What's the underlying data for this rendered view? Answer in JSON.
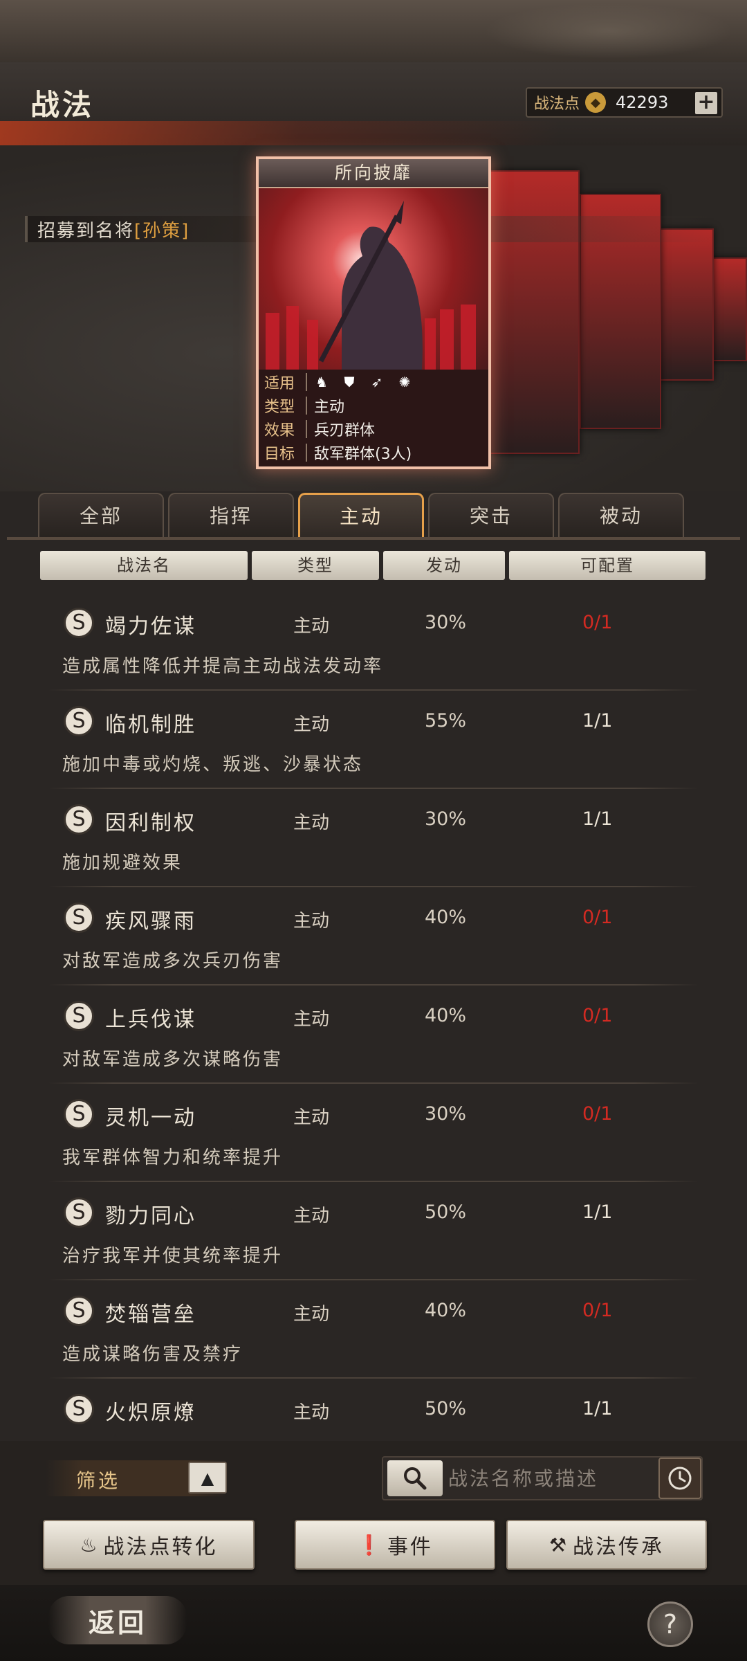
{
  "header": {
    "title": "战法",
    "points_label": "战法点",
    "points_value": "42293",
    "add_label": "+"
  },
  "recruit": {
    "text": "招募到名将",
    "name": "[孙策]"
  },
  "featured_card": {
    "title": "所向披靡",
    "info": [
      {
        "key": "适用",
        "value": ""
      },
      {
        "key": "类型",
        "value": "主动"
      },
      {
        "key": "效果",
        "value": "兵刃群体"
      },
      {
        "key": "目标",
        "value": "敌军群体(3人)"
      }
    ],
    "unit_icons": [
      "cavalry-icon",
      "shield-icon",
      "archer-icon",
      "chariot-icon"
    ]
  },
  "tabs": [
    {
      "label": "全部",
      "active": false
    },
    {
      "label": "指挥",
      "active": false
    },
    {
      "label": "主动",
      "active": true
    },
    {
      "label": "突击",
      "active": false
    },
    {
      "label": "被动",
      "active": false
    }
  ],
  "table_headers": [
    "战法名",
    "类型",
    "发动",
    "可配置"
  ],
  "skills": [
    {
      "grade": "S",
      "name": "竭力佐谋",
      "type": "主动",
      "rate": "30%",
      "slot": "0/1",
      "slot_full": true,
      "desc": "造成属性降低并提高主动战法发动率"
    },
    {
      "grade": "S",
      "name": "临机制胜",
      "type": "主动",
      "rate": "55%",
      "slot": "1/1",
      "slot_full": false,
      "desc": "施加中毒或灼烧、叛逃、沙暴状态"
    },
    {
      "grade": "S",
      "name": "因利制权",
      "type": "主动",
      "rate": "30%",
      "slot": "1/1",
      "slot_full": false,
      "desc": "施加规避效果"
    },
    {
      "grade": "S",
      "name": "疾风骤雨",
      "type": "主动",
      "rate": "40%",
      "slot": "0/1",
      "slot_full": true,
      "desc": "对敌军造成多次兵刃伤害"
    },
    {
      "grade": "S",
      "name": "上兵伐谋",
      "type": "主动",
      "rate": "40%",
      "slot": "0/1",
      "slot_full": true,
      "desc": "对敌军造成多次谋略伤害"
    },
    {
      "grade": "S",
      "name": "灵机一动",
      "type": "主动",
      "rate": "30%",
      "slot": "0/1",
      "slot_full": true,
      "desc": "我军群体智力和统率提升"
    },
    {
      "grade": "S",
      "name": "勠力同心",
      "type": "主动",
      "rate": "50%",
      "slot": "1/1",
      "slot_full": false,
      "desc": "治疗我军并使其统率提升"
    },
    {
      "grade": "S",
      "name": "焚辎营垒",
      "type": "主动",
      "rate": "40%",
      "slot": "0/1",
      "slot_full": true,
      "desc": "造成谋略伤害及禁疗"
    },
    {
      "grade": "S",
      "name": "火炽原燎",
      "type": "主动",
      "rate": "50%",
      "slot": "1/1",
      "slot_full": false,
      "desc": ""
    }
  ],
  "filter": {
    "label": "筛选",
    "toggle_icon": "up-triangle-icon"
  },
  "search": {
    "placeholder": "战法名称或描述"
  },
  "actions": {
    "convert_label": "战法点转化",
    "event_label": "事件",
    "inherit_label": "战法传承"
  },
  "footer": {
    "back_label": "返回",
    "help_label": "?"
  },
  "colors": {
    "accent_gold": "#e6a04a",
    "slot_full_red": "#d32a22",
    "card_red": "#8f1d1f"
  }
}
